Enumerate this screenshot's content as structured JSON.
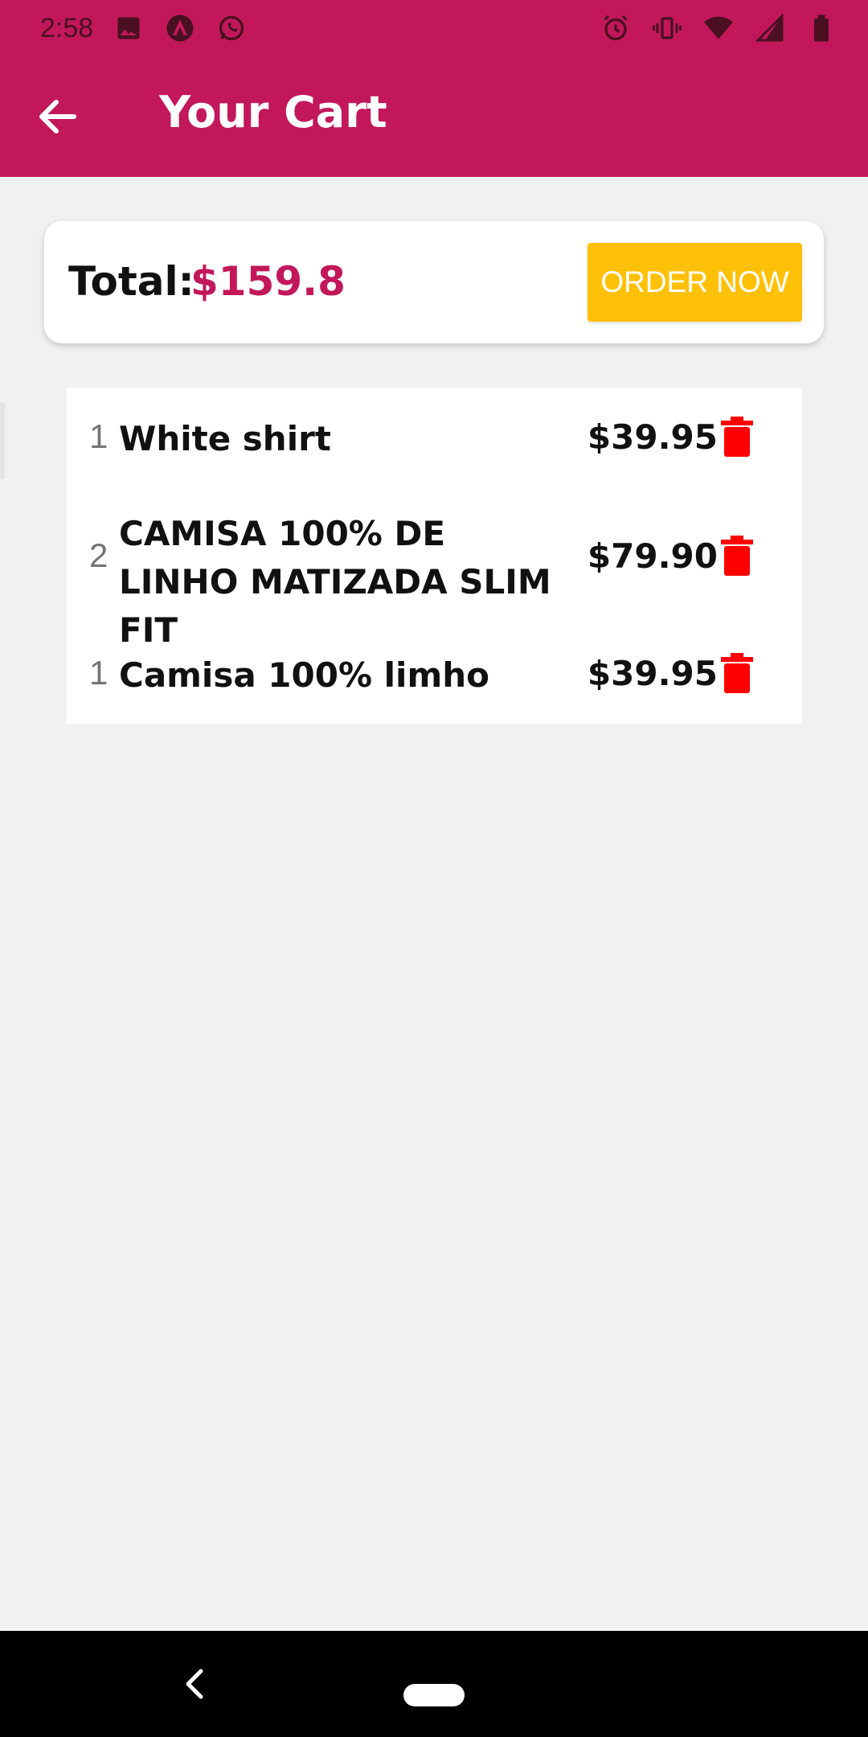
{
  "status_bar": {
    "time": "2:58",
    "icons_left": [
      "image-icon",
      "app-icon",
      "whatsapp-icon"
    ],
    "icons_right": [
      "alarm-icon",
      "vibrate-icon",
      "wifi-icon",
      "signal-icon",
      "battery-icon"
    ]
  },
  "header": {
    "title": "Your Cart",
    "back_icon": "arrow-left-icon",
    "background": "#c2185b"
  },
  "summary": {
    "total_label": "Total:",
    "total_amount": "$159.8",
    "order_button": "ORDER NOW",
    "accent": "#c2185b",
    "button_color": "#ffc107"
  },
  "cart": {
    "items": [
      {
        "qty": "1",
        "name": "White shirt",
        "price": "$39.95"
      },
      {
        "qty": "2",
        "name": "CAMISA 100% DE LINHO MATIZADA SLIM FIT",
        "price": "$79.90"
      },
      {
        "qty": "1",
        "name": "Camisa 100% limho",
        "price": "$39.95"
      }
    ],
    "delete_icon": "trash-icon",
    "delete_color": "#ff0000"
  },
  "nav_bar": {
    "icons": [
      "back-icon",
      "home-pill"
    ]
  }
}
